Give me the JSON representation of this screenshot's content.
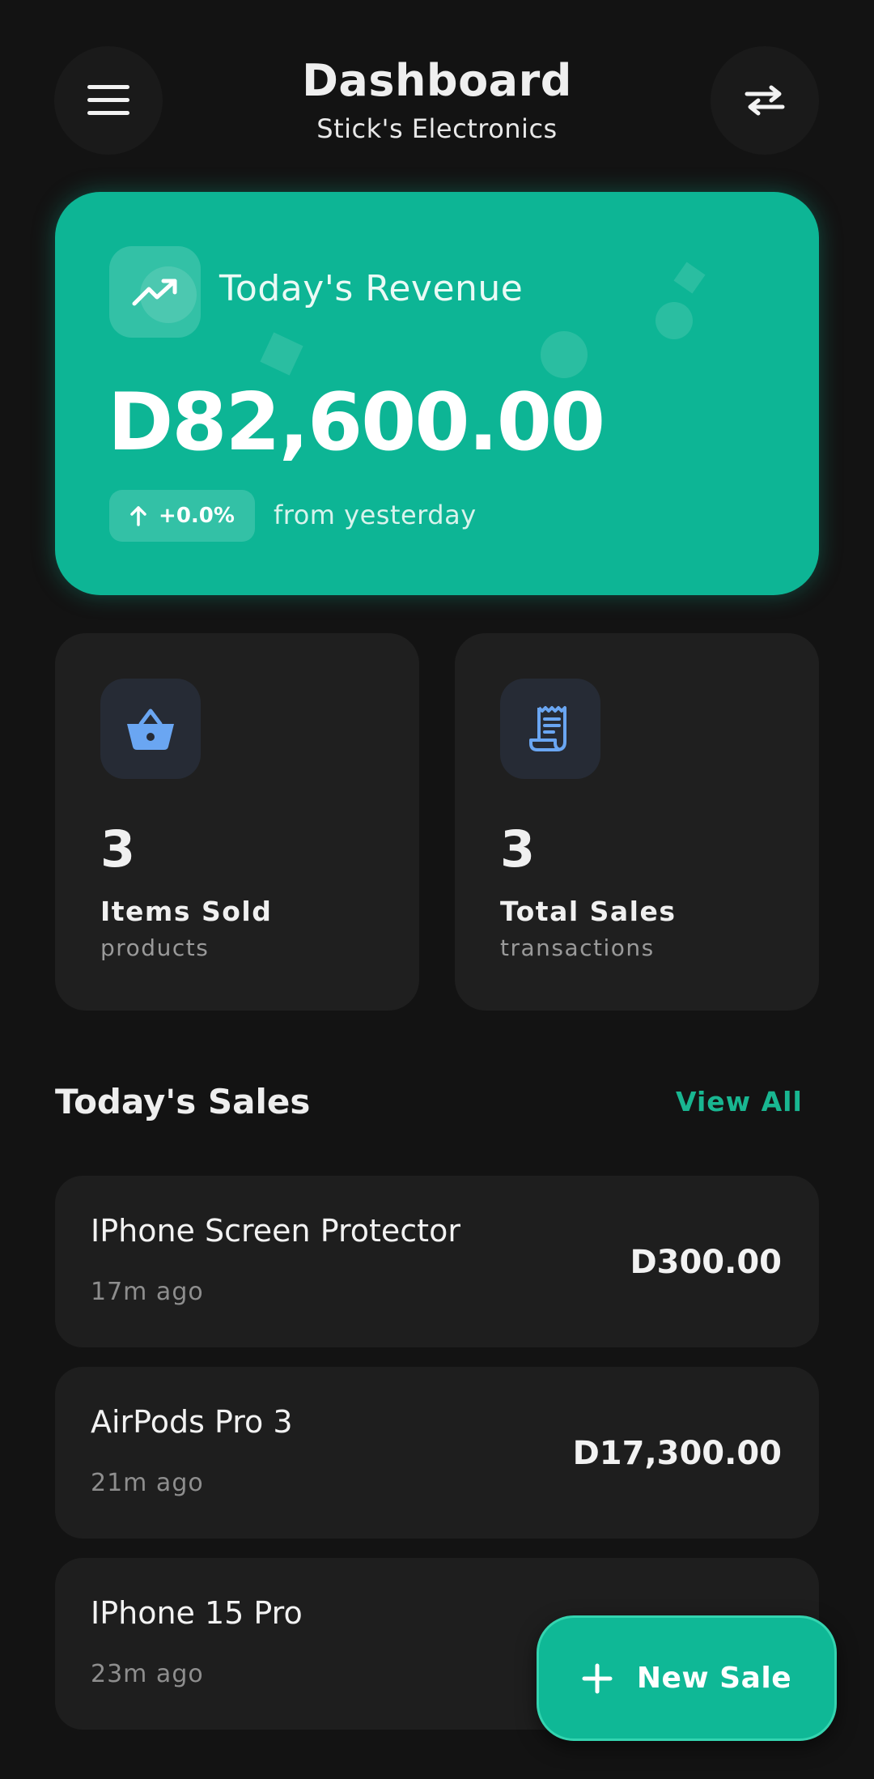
{
  "header": {
    "title": "Dashboard",
    "subtitle": "Stick's Electronics",
    "menu_icon": "menu-icon",
    "switch_icon": "swap-arrows-icon"
  },
  "revenue": {
    "label": "Today's Revenue",
    "amount": "D82,600.00",
    "change": "+0.0%",
    "change_suffix": "from yesterday",
    "icon": "trending-up-icon",
    "accent_color": "#0db595"
  },
  "stats": [
    {
      "value": "3",
      "label": "Items Sold",
      "sub": "products",
      "icon": "basket-icon"
    },
    {
      "value": "3",
      "label": "Total Sales",
      "sub": "transactions",
      "icon": "receipt-icon"
    }
  ],
  "sales_section": {
    "title": "Today's Sales",
    "view_all": "View All"
  },
  "sales": [
    {
      "name": "IPhone Screen Protector",
      "time": "17m ago",
      "amount": "D300.00"
    },
    {
      "name": "AirPods Pro 3",
      "time": "21m ago",
      "amount": "D17,300.00"
    },
    {
      "name": "IPhone 15 Pro",
      "time": "23m ago",
      "amount": ""
    }
  ],
  "fab": {
    "label": "New Sale",
    "icon": "plus-icon"
  },
  "colors": {
    "background": "#131313",
    "card": "#1f1f1f",
    "accent": "#0db595",
    "icon_blue": "#6aa6f2"
  }
}
